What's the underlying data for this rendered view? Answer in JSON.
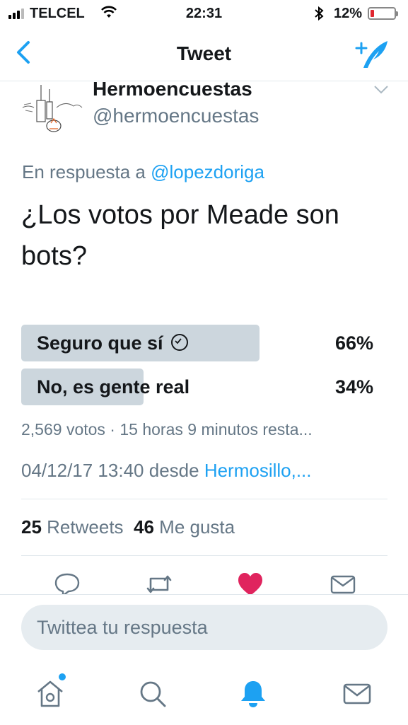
{
  "status_bar": {
    "carrier": "TELCEL",
    "time": "22:31",
    "battery_percent": "12%",
    "battery_level": 0.12
  },
  "nav": {
    "title": "Tweet"
  },
  "tweet": {
    "author_name": "Hermoencuestas",
    "author_handle": "@hermoencuestas",
    "reply_prefix": "En respuesta a",
    "reply_to": "@lopezdoriga",
    "text": "¿Los votos por Meade son bots?",
    "poll": {
      "options": [
        {
          "label": "Seguro que sí",
          "percent_label": "66%",
          "percent": 66,
          "selected": true
        },
        {
          "label": "No, es gente real",
          "percent_label": "34%",
          "percent": 34,
          "selected": false
        }
      ],
      "summary": "2,569 votos · 15 horas 9 minutos resta..."
    },
    "timestamp": "04/12/17 13:40",
    "source_prefix": "desde",
    "location": "Hermosillo,...",
    "retweets_count": "25",
    "retweets_label": "Retweets",
    "likes_count": "46",
    "likes_label": "Me gusta"
  },
  "actions": [
    "reply-icon",
    "retweet-icon",
    "like-icon",
    "message-icon"
  ],
  "reply_box": {
    "placeholder": "Twittea tu respuesta"
  },
  "tab_bar": [
    "home-icon",
    "search-icon",
    "notifications-icon",
    "messages-icon"
  ],
  "colors": {
    "accent": "#1da1f2",
    "like": "#e0245e",
    "poll_bar": "#ccd6dd",
    "muted": "#657786",
    "battery_low": "#e0262f"
  }
}
